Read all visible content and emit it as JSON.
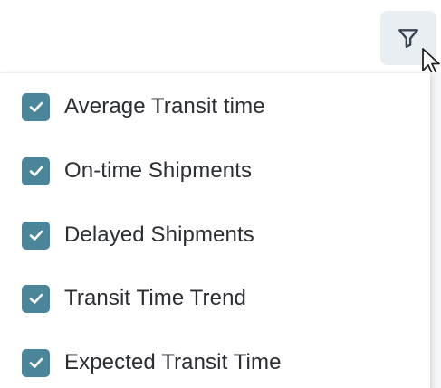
{
  "toolbar": {
    "filter_icon": "filter-funnel-icon",
    "button_bg_color": "#e9eef3"
  },
  "filter_menu": {
    "checkbox_color": "#4a8599",
    "options": [
      {
        "label": "Average Transit time",
        "checked": true
      },
      {
        "label": "On-time Shipments",
        "checked": true
      },
      {
        "label": "Delayed Shipments",
        "checked": true
      },
      {
        "label": "Transit Time Trend",
        "checked": true
      },
      {
        "label": "Expected Transit Time",
        "checked": true
      }
    ]
  }
}
